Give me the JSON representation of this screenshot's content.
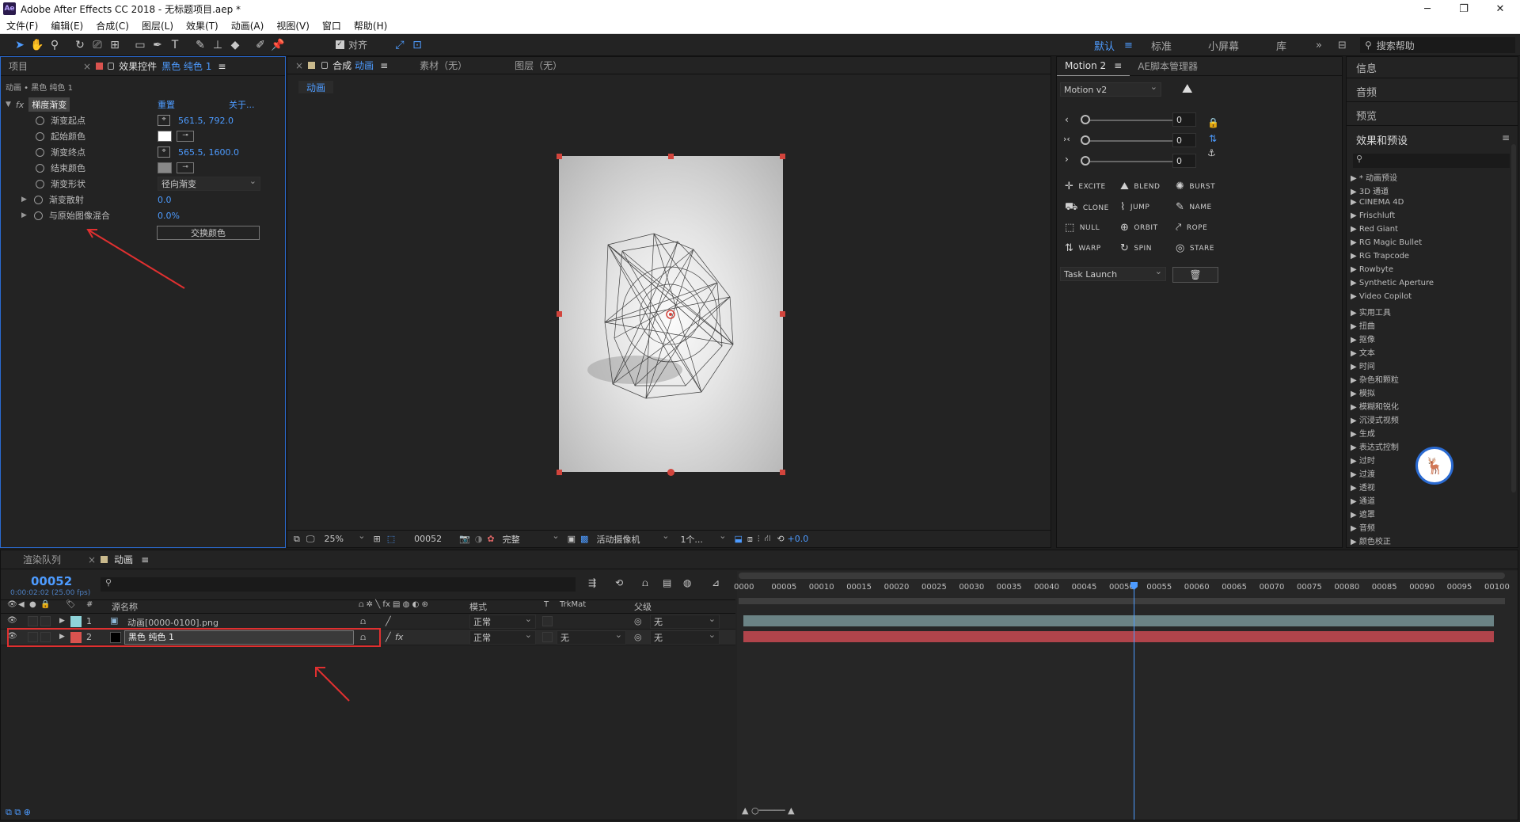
{
  "window": {
    "title": "Adobe After Effects CC 2018 - 无标题项目.aep *",
    "logo": "Ae"
  },
  "menu": [
    "文件(F)",
    "编辑(E)",
    "合成(C)",
    "图层(L)",
    "效果(T)",
    "动画(A)",
    "视图(V)",
    "窗口",
    "帮助(H)"
  ],
  "toolbar": {
    "snap_label": "对齐"
  },
  "workspaces": {
    "items": [
      "默认",
      "标准",
      "小屏幕",
      "库"
    ],
    "active": "默认",
    "search_placeholder": "搜索帮助"
  },
  "project_panel": {
    "tab_project": "项目",
    "tab_effects": "效果控件",
    "effects_target": "黑色 纯色 1"
  },
  "effect_controls": {
    "breadcrumb": "动画 • 黑色 纯色 1",
    "effect_name": "梯度渐变",
    "reset": "重置",
    "about": "关于...",
    "params": [
      {
        "label": "渐变起点",
        "value": "561.5, 792.0"
      },
      {
        "label": "起始颜色",
        "value": ""
      },
      {
        "label": "渐变终点",
        "value": "565.5, 1600.0"
      },
      {
        "label": "结束颜色",
        "value": ""
      },
      {
        "label": "渐变形状",
        "value": "径向渐变"
      },
      {
        "label": "渐变散射",
        "value": "0.0"
      },
      {
        "label": "与原始图像混合",
        "value": "0.0%"
      }
    ],
    "swap_button": "交换颜色",
    "colors": {
      "start": "#ffffff",
      "end": "#888888"
    }
  },
  "comp_panel": {
    "tab_comp_prefix": "合成",
    "tab_comp": "动画",
    "tab_footage": "素材（无）",
    "tab_layer": "图层（无）",
    "sub_tab": "动画"
  },
  "viewer_bar": {
    "zoom": "25%",
    "timecode": "00052",
    "resolution": "完整",
    "camera": "活动摄像机",
    "views": "1个...",
    "exposure": "+0.0"
  },
  "motion2": {
    "tab": "Motion 2",
    "tab2": "AE脚本管理器",
    "version": "Motion v2",
    "sliders": [
      {
        "icon": "‹",
        "value": "0"
      },
      {
        "icon": "›‹",
        "value": "0"
      },
      {
        "icon": "›",
        "value": "0"
      }
    ],
    "buttons": [
      {
        "icon": "✛",
        "label": "EXCITE"
      },
      {
        "icon": "⛰",
        "label": "BLEND"
      },
      {
        "icon": "✺",
        "label": "BURST"
      },
      {
        "icon": "⛟",
        "label": "CLONE"
      },
      {
        "icon": "⌇",
        "label": "JUMP"
      },
      {
        "icon": "✎",
        "label": "NAME"
      },
      {
        "icon": "⬚",
        "label": "NULL"
      },
      {
        "icon": "⊕",
        "label": "ORBIT"
      },
      {
        "icon": "⤤",
        "label": "ROPE"
      },
      {
        "icon": "⇅",
        "label": "WARP"
      },
      {
        "icon": "↻",
        "label": "SPIN"
      },
      {
        "icon": "◎",
        "label": "STARE"
      }
    ],
    "task": "Task Launch"
  },
  "right_panel": {
    "items": [
      "信息",
      "音频",
      "预览"
    ],
    "effects_title": "效果和预设",
    "effects_list": [
      "* 动画预设",
      "3D 通道",
      "CINEMA 4D",
      "Frischluft",
      "Red Giant",
      "RG Magic Bullet",
      "RG Trapcode",
      "Rowbyte",
      "Synthetic Aperture",
      "Video Copilot",
      "实用工具",
      "扭曲",
      "抠像",
      "文本",
      "时间",
      "杂色和颗粒",
      "模拟",
      "模糊和锐化",
      "沉浸式视频",
      "生成",
      "表达式控制",
      "过时",
      "过渡",
      "透视",
      "通道",
      "遮罩",
      "音频",
      "颜色校正"
    ]
  },
  "timeline": {
    "tab_render": "渲染队列",
    "tab_comp": "动画",
    "timecode": "00052",
    "timecode_sub": "0:00:02:02 (25.00 fps)",
    "columns": {
      "source": "源名称",
      "mode": "模式",
      "trkmat": "TrkMat",
      "parent": "父级",
      "num": "#"
    },
    "layers": [
      {
        "num": "1",
        "name": "动画[0000-0100].png",
        "mode": "正常",
        "trkmat": "",
        "parent": "无",
        "label_color": "#8fd3d9"
      },
      {
        "num": "2",
        "name": "黑色 纯色 1",
        "mode": "正常",
        "trkmat": "无",
        "parent": "无",
        "label_color": "#d9534f"
      }
    ],
    "ruler": [
      "0000",
      "00005",
      "00010",
      "00015",
      "00020",
      "00025",
      "00030",
      "00035",
      "00040",
      "00045",
      "00050",
      "00055",
      "00060",
      "00065",
      "00070",
      "00075",
      "00080",
      "00085",
      "00090",
      "00095",
      "00100"
    ],
    "playhead_frame": 52,
    "total_frames": 100
  }
}
